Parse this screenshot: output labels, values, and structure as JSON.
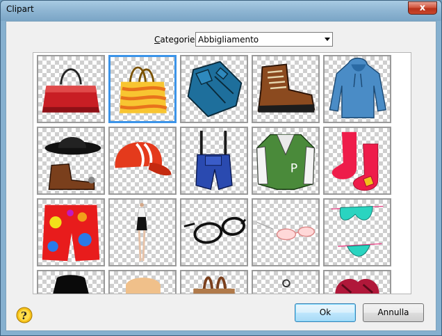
{
  "window": {
    "title": "Clipart"
  },
  "toolbar": {
    "close_glyph": "x"
  },
  "category": {
    "label_first": "C",
    "label_rest": "ategorie",
    "selected": "Abbigliamento"
  },
  "gallery": {
    "selected_index": 1,
    "items": [
      "red-handbag-icon",
      "yellow-tote-bag-icon",
      "blue-shirt-icon",
      "brown-boot-icon",
      "blue-hoodie-icon",
      "cowboy-hat-and-boot-icon",
      "red-cap-icon",
      "blue-overalls-icon",
      "green-jacket-icon",
      "red-socks-icon",
      "colorful-shorts-icon",
      "dress-mannequin-icon",
      "black-glasses-icon",
      "pink-glasses-icon",
      "bikini-icon",
      "black-shirt-icon",
      "hand-glove-icon",
      "brown-bag-icon",
      "sunglasses-icon",
      "red-gloves-icon"
    ]
  },
  "buttons": {
    "ok": "Ok",
    "cancel": "Annulla"
  },
  "colors": {
    "selection": "#3b93e8",
    "accent": "#3c7fb1"
  }
}
